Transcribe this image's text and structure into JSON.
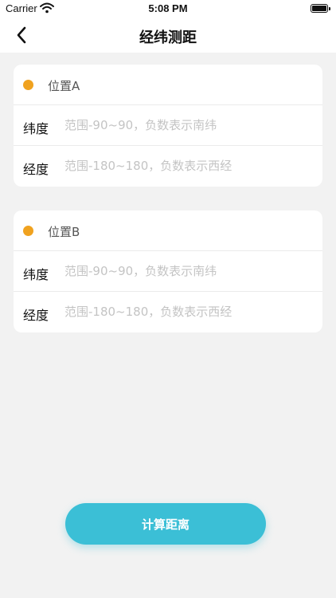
{
  "status_bar": {
    "carrier": "Carrier",
    "time": "5:08 PM"
  },
  "nav": {
    "title": "经纬测距",
    "back_icon": "chevron-left-icon"
  },
  "location_a": {
    "title": "位置A",
    "latitude_label": "纬度",
    "latitude_placeholder": "范围-90~90，负数表示南纬",
    "latitude_value": "",
    "longitude_label": "经度",
    "longitude_placeholder": "范围-180~180，负数表示西经",
    "longitude_value": ""
  },
  "location_b": {
    "title": "位置B",
    "latitude_label": "纬度",
    "latitude_placeholder": "范围-90~90，负数表示南纬",
    "latitude_value": "",
    "longitude_label": "经度",
    "longitude_placeholder": "范围-180~180，负数表示西经",
    "longitude_value": ""
  },
  "calculate_button": {
    "label": "计算距离"
  },
  "colors": {
    "accent": "#3bbfd6",
    "dot": "#f0a21f",
    "background": "#f2f2f2"
  }
}
